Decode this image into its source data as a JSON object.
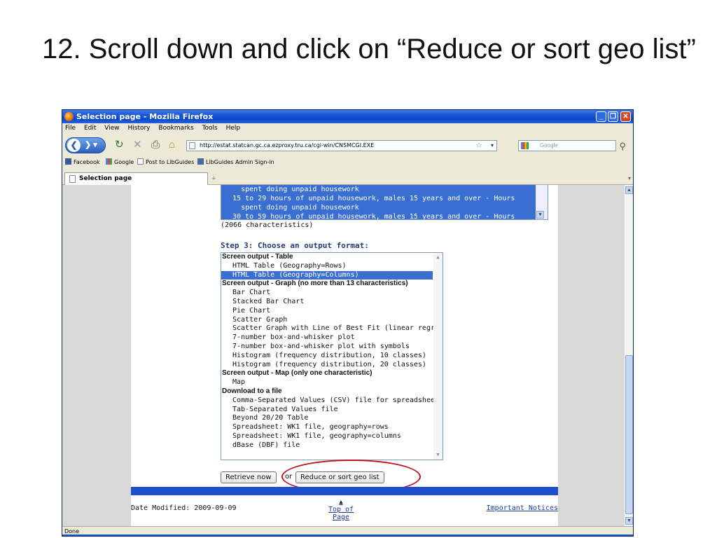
{
  "slide": {
    "title": "12. Scroll down and click on “Reduce or sort geo list”"
  },
  "window": {
    "title": "Selection page - Mozilla Firefox"
  },
  "menu": [
    "File",
    "Edit",
    "View",
    "History",
    "Bookmarks",
    "Tools",
    "Help"
  ],
  "nav": {
    "url": "http://estat.statcan.gc.ca.ezproxy.tru.ca/cgi-win/CNSMCGI.EXE",
    "search_placeholder": "Google"
  },
  "bookmarks": [
    "Facebook",
    "Google",
    "Post to LibGuides",
    "LibGuides Admin Sign-in"
  ],
  "tab": {
    "label": "Selection page"
  },
  "page": {
    "characteristics_lines": [
      "    spent doing unpaid housework",
      "  15 to 29 hours of unpaid housework, males 15 years and over - Hours",
      "    spent doing unpaid housework",
      "  30 to 59 hours of unpaid housework, males 15 years and over - Hours"
    ],
    "characteristics_count": "(2066 characteristics)",
    "step3_heading": "Step 3: Choose an output format:",
    "output_groups": [
      {
        "label": "Screen output - Table",
        "options": [
          "HTML Table (Geography=Rows)",
          "HTML Table (Geography=Columns)"
        ]
      },
      {
        "label": "Screen output - Graph (no more than 13 characteristics)",
        "options": [
          "Bar Chart",
          "Stacked Bar Chart",
          "Pie Chart",
          "Scatter Graph",
          "Scatter Graph with Line of Best Fit (linear regression)",
          "7-number box-and-whisker plot",
          "7-number box-and-whisker plot with symbols",
          "Histogram (frequency distribution, 10 classes)",
          "Histogram (frequency distribution, 20 classes)"
        ]
      },
      {
        "label": "Screen output - Map (only one characteristic)",
        "options": [
          "Map"
        ]
      },
      {
        "label": "Download to a file",
        "options": [
          "Comma-Separated Values (CSV) file for spreadsheet",
          "Tab-Separated Values file",
          "Beyond 20/20 Table",
          "Spreadsheet: WK1 file, geography=rows",
          "Spreadsheet: WK1 file, geography=columns",
          "dBase (DBF) file"
        ]
      }
    ],
    "selected_option": "HTML Table (Geography=Columns)",
    "retrieve_button": "Retrieve now",
    "or_text": "or",
    "reduce_button": "Reduce or sort geo list",
    "date_modified": "Date Modified: 2009-09-09",
    "top_of_page": "Top of Page",
    "important_notices": "Important Notices"
  },
  "status": {
    "text": "Done"
  },
  "colors": {
    "selection": "#3a6fd1",
    "callout": "#c0141c",
    "footer_bar": "#1f4fcf"
  }
}
